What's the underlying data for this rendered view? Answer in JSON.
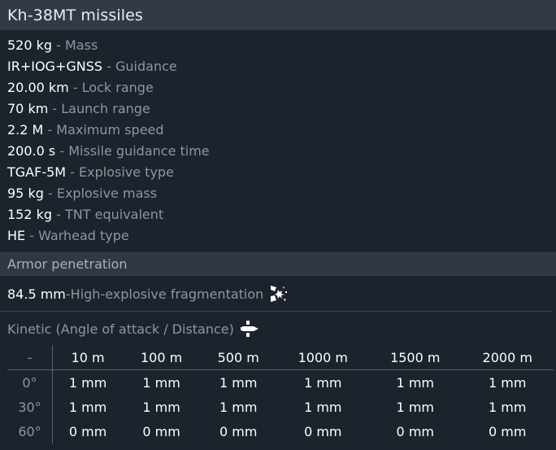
{
  "title": "Kh-38MT missiles",
  "stats": [
    {
      "value": "520 kg",
      "label": "Mass"
    },
    {
      "value": "IR+IOG+GNSS",
      "label": "Guidance"
    },
    {
      "value": "20.00 km",
      "label": "Lock range"
    },
    {
      "value": "70 km",
      "label": "Launch range"
    },
    {
      "value": "2.2 M",
      "label": "Maximum speed"
    },
    {
      "value": "200.0 s",
      "label": "Missile guidance time"
    },
    {
      "value": "TGAF-5M",
      "label": "Explosive type"
    },
    {
      "value": "95 kg",
      "label": "Explosive mass"
    },
    {
      "value": "152 kg",
      "label": "TNT equivalent"
    },
    {
      "value": "HE",
      "label": "Warhead type"
    }
  ],
  "separator": " - ",
  "armor": {
    "section_title": "Armor penetration",
    "he_value": "84.5 mm",
    "he_label": "High-explosive fragmentation",
    "he_icon": "fragmentation-explosion-icon",
    "kinetic_label": "Kinetic (Angle of attack / Distance)",
    "kinetic_icon": "kinetic-shell-icon",
    "table": {
      "corner": "-",
      "columns": [
        "10 m",
        "100 m",
        "500 m",
        "1000 m",
        "1500 m",
        "2000 m"
      ],
      "rows": [
        {
          "angle": "0°",
          "values": [
            "1 mm",
            "1 mm",
            "1 mm",
            "1 mm",
            "1 mm",
            "1 mm"
          ]
        },
        {
          "angle": "30°",
          "values": [
            "1 mm",
            "1 mm",
            "1 mm",
            "1 mm",
            "1 mm",
            "1 mm"
          ]
        },
        {
          "angle": "60°",
          "values": [
            "0 mm",
            "0 mm",
            "0 mm",
            "0 mm",
            "0 mm",
            "0 mm"
          ]
        }
      ]
    }
  }
}
